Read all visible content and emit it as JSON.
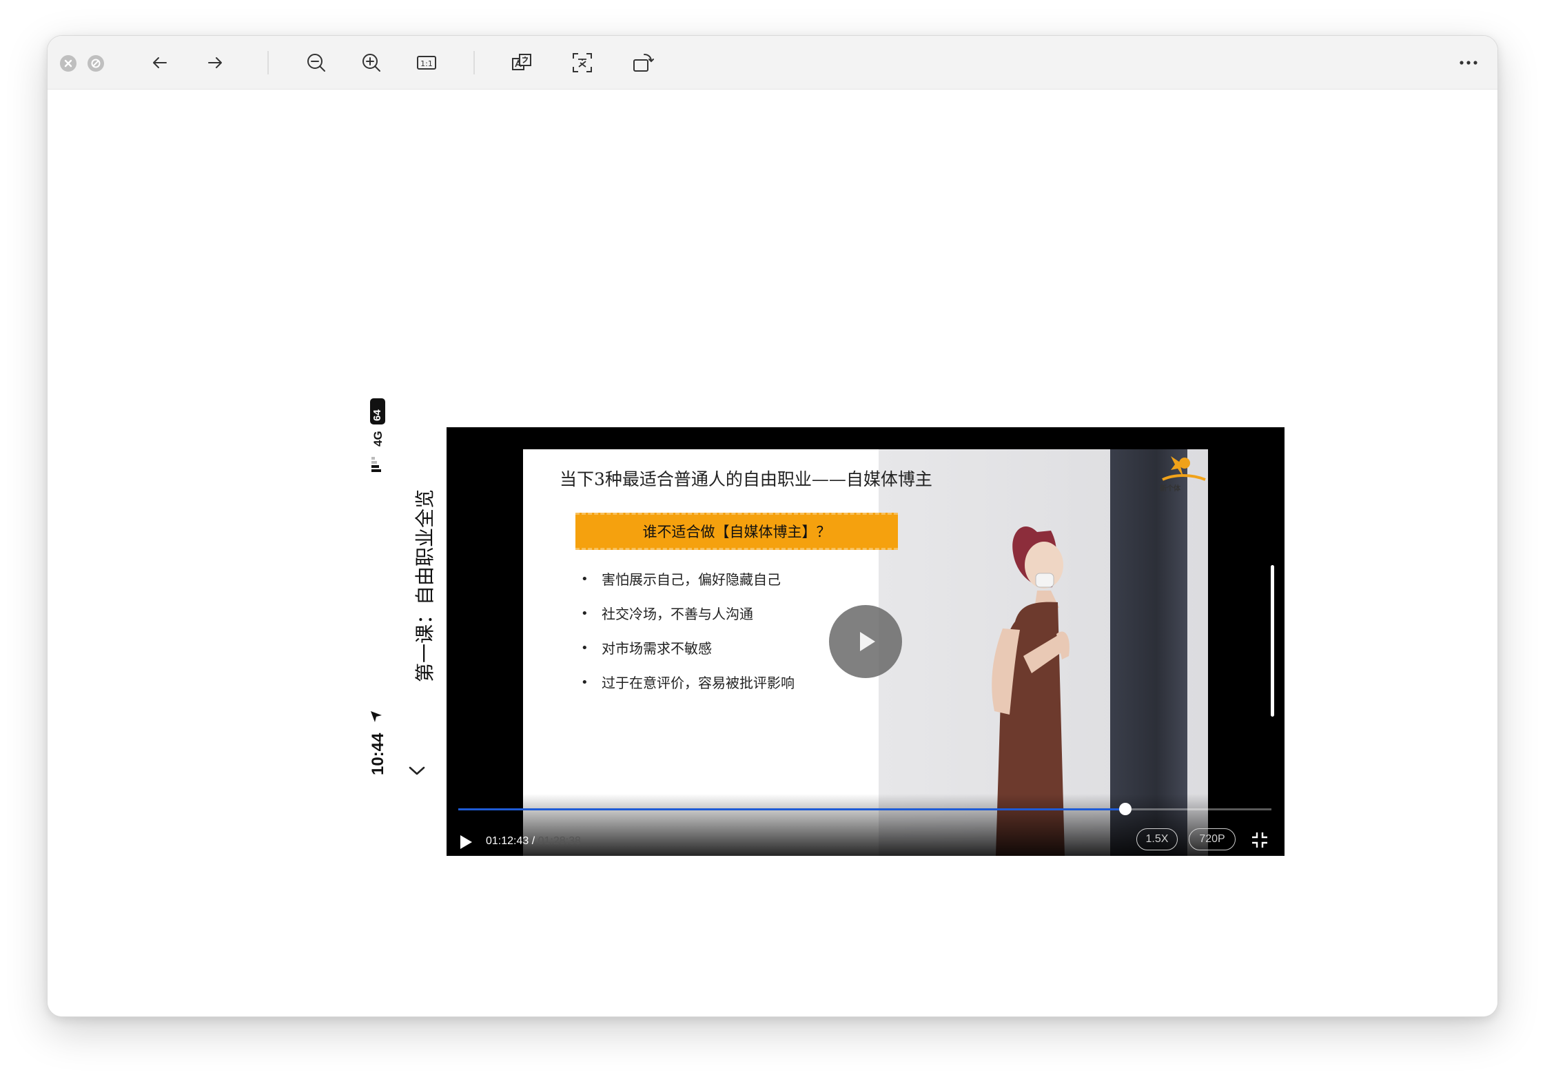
{
  "viewer": {
    "toolbar": {
      "close_icon": "close-icon",
      "minimize_icon": "minimize-icon",
      "back_icon": "arrow-left-icon",
      "forward_icon": "arrow-right-icon",
      "zoom_out_icon": "zoom-out-icon",
      "zoom_in_icon": "zoom-in-icon",
      "actual_size_icon": "actual-size-icon",
      "actual_size_label": "1:1",
      "translate_icon": "translate-icon",
      "ocr_icon": "text-recognition-icon",
      "rotate_icon": "rotate-icon",
      "more_icon": "more-icon"
    }
  },
  "phone": {
    "status": {
      "time": "10:44",
      "network": "4G",
      "battery": "64"
    },
    "course_title": "第一课：自由职业全览",
    "video": {
      "slide": {
        "title": "当下3种最适合普通人的自由职业——自媒体博主",
        "banner": "谁不适合做【自媒体博主】？",
        "bullets": [
          "害怕展示自己，偏好隐藏自己",
          "社交冷场，不善与人沟通",
          "对市场需求不敏感",
          "过于在意评价，容易被批评影响"
        ],
        "logo_text": "新个体"
      },
      "current_time": "01:12:43",
      "separator": " / ",
      "total_time": "01:28:38",
      "progress": 0.82,
      "speed": "1.5X",
      "quality": "720P"
    }
  }
}
